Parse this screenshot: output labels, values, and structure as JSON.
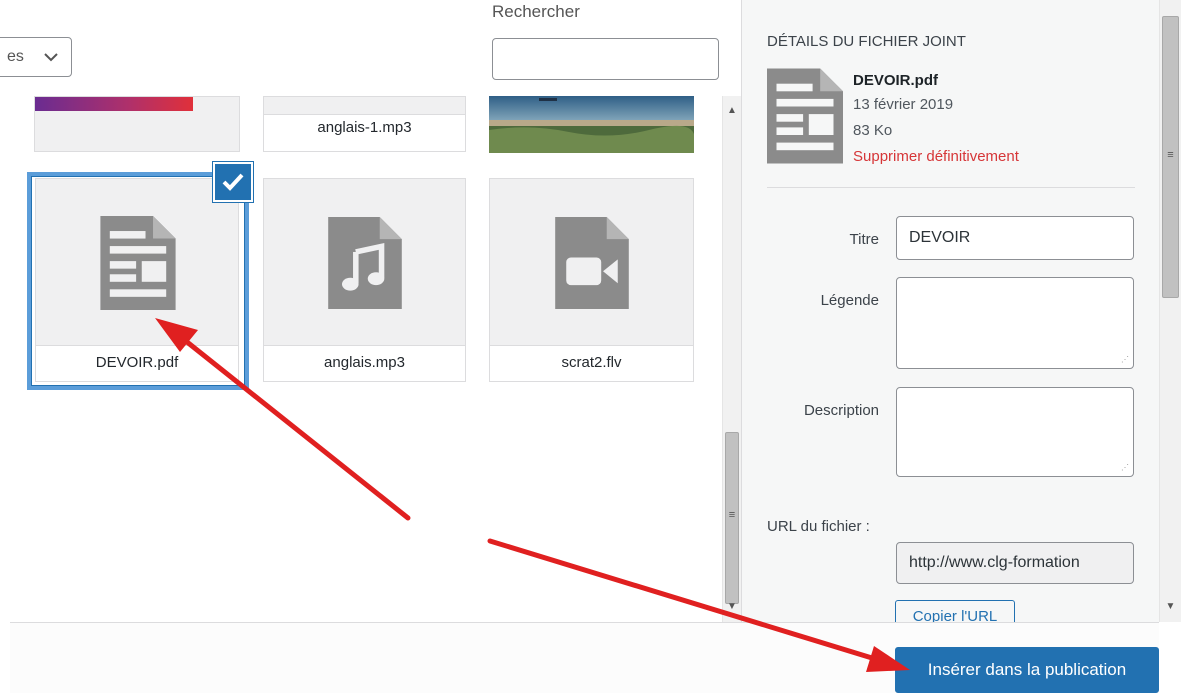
{
  "filter": {
    "value": "es"
  },
  "search": {
    "label": "Rechercher",
    "value": ""
  },
  "grid": {
    "items": [
      {
        "caption": "",
        "kind": "image"
      },
      {
        "caption": "anglais-1.mp3",
        "kind": "audio"
      },
      {
        "caption": "",
        "kind": "image"
      },
      {
        "caption": "DEVOIR.pdf",
        "kind": "document",
        "selected": true
      },
      {
        "caption": "anglais.mp3",
        "kind": "audio"
      },
      {
        "caption": "scrat2.flv",
        "kind": "video"
      }
    ]
  },
  "details": {
    "heading": "DÉTAILS DU FICHIER JOINT",
    "filename": "DEVOIR.pdf",
    "date": "13 février 2019",
    "size": "83 Ko",
    "delete_label": "Supprimer définitivement",
    "fields": {
      "title": {
        "label": "Titre",
        "value": "DEVOIR"
      },
      "caption": {
        "label": "Légende",
        "value": ""
      },
      "description": {
        "label": "Description",
        "value": ""
      },
      "url": {
        "label": "URL du fichier :",
        "value": "http://www.clg-formation"
      }
    },
    "copy_url_label": "Copier l'URL"
  },
  "toolbar": {
    "insert_label": "Insérer dans la publication"
  },
  "colors": {
    "accent": "#2271b1",
    "selection": "#5b9dd9",
    "danger": "#d63638",
    "annotation_arrow": "#e02020"
  },
  "icons": [
    "chevron-down-icon",
    "document-icon",
    "audio-file-icon",
    "video-file-icon",
    "checkmark-icon",
    "resize-grip-icon",
    "scroll-up-icon",
    "scroll-down-icon"
  ]
}
